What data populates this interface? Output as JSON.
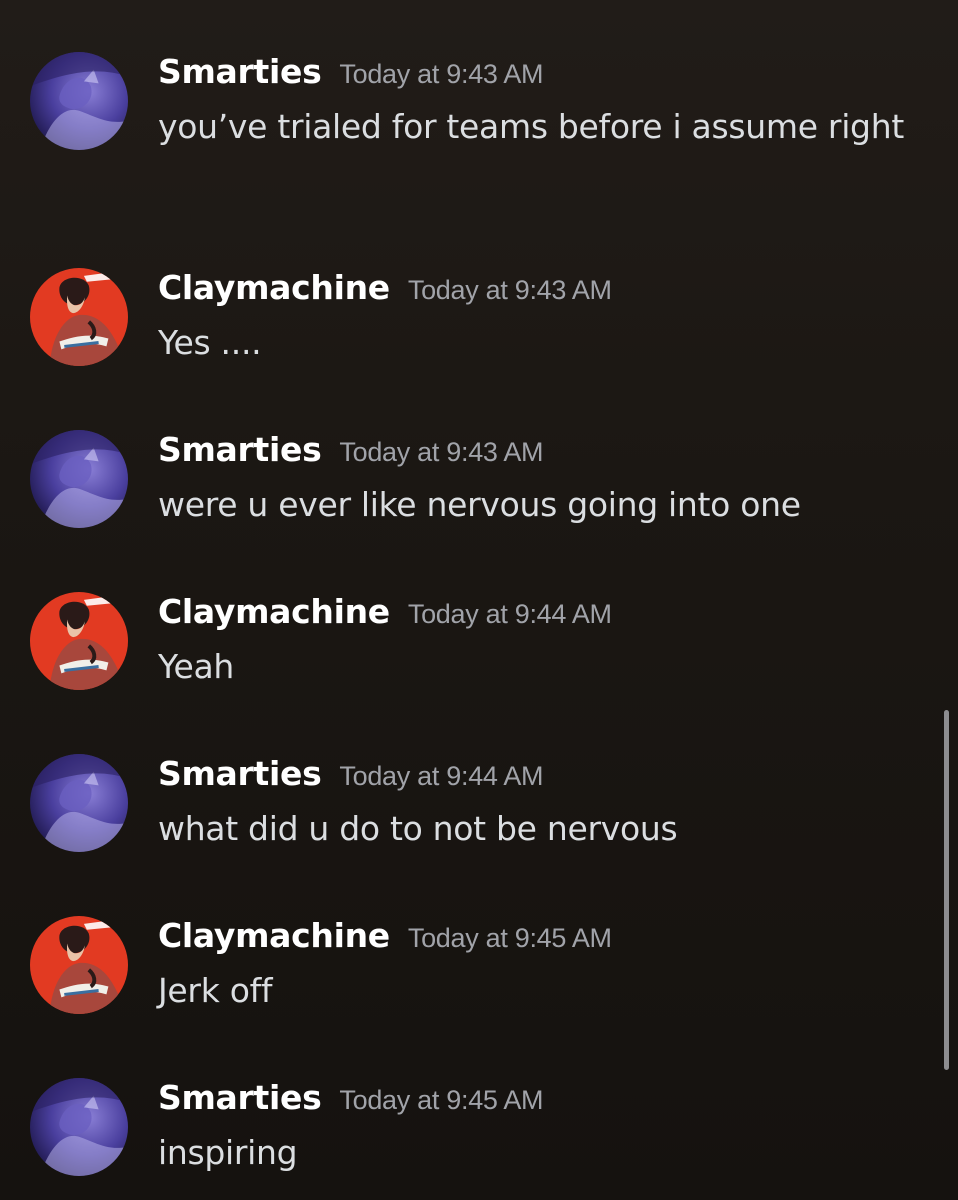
{
  "messages": [
    {
      "author": "Smarties",
      "timestamp": "Today at 9:43 AM",
      "text": "you’ve trialed for teams before i assume right",
      "avatar": "smarties-avatar"
    },
    {
      "author": "Claymachine",
      "timestamp": "Today at 9:43 AM",
      "text": "Yes ....",
      "avatar": "claymachine-avatar"
    },
    {
      "author": "Smarties",
      "timestamp": "Today at 9:43 AM",
      "text": "were u ever like nervous going into one",
      "avatar": "smarties-avatar"
    },
    {
      "author": "Claymachine",
      "timestamp": "Today at 9:44 AM",
      "text": "Yeah",
      "avatar": "claymachine-avatar"
    },
    {
      "author": "Smarties",
      "timestamp": "Today at 9:44 AM",
      "text": "what did u do to not be nervous",
      "avatar": "smarties-avatar"
    },
    {
      "author": "Claymachine",
      "timestamp": "Today at 9:45 AM",
      "text": "Jerk off",
      "avatar": "claymachine-avatar"
    },
    {
      "author": "Smarties",
      "timestamp": "Today at 9:45 AM",
      "text": "inspiring",
      "avatar": "smarties-avatar"
    }
  ],
  "colors": {
    "background": "#1b1713",
    "username": "#ffffff",
    "timestamp": "#a1a3a9",
    "message_text": "#dbdee1"
  }
}
